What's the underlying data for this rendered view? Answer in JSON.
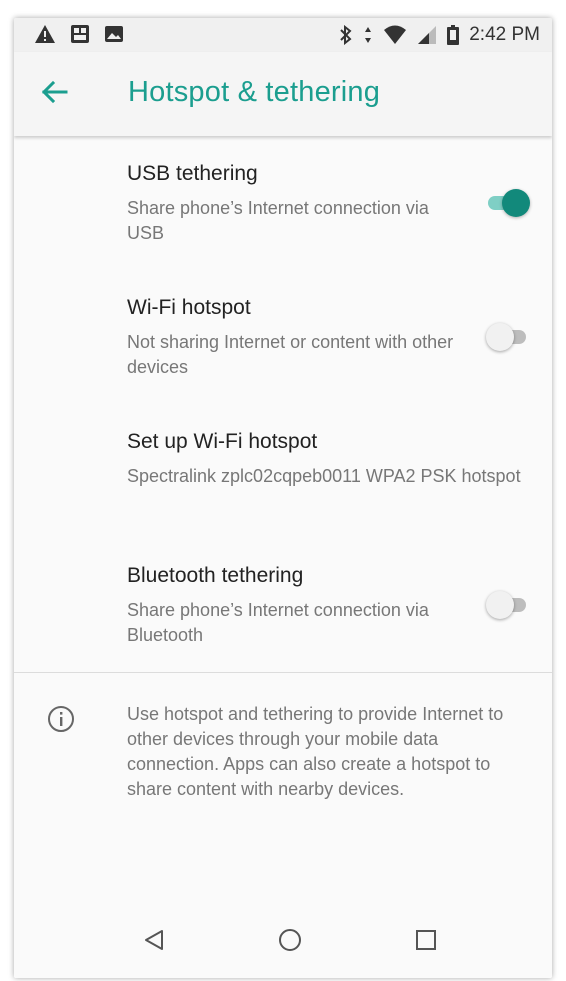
{
  "status_bar": {
    "time": "2:42 PM",
    "left_icons": [
      "warning-icon",
      "sim-icon",
      "image-icon"
    ],
    "right_icons": [
      "bluetooth-icon",
      "data-arrows-icon",
      "wifi-icon",
      "signal-icon",
      "battery-icon"
    ]
  },
  "toolbar": {
    "title": "Hotspot & tethering",
    "back_icon": "back-arrow-icon"
  },
  "settings": [
    {
      "title": "USB tethering",
      "subtitle": "Share phone’s Internet connection via USB",
      "toggle": true
    },
    {
      "title": "Wi-Fi hotspot",
      "subtitle": "Not sharing Internet or content with other devices",
      "toggle": false
    },
    {
      "title": "Set up Wi-Fi hotspot",
      "subtitle": "Spectralink zplc02cqpeb0011 WPA2 PSK hotspot"
    },
    {
      "title": "Bluetooth tethering",
      "subtitle": "Share phone’s Internet connection via Bluetooth",
      "toggle": false
    }
  ],
  "info": {
    "icon": "info-icon",
    "text": "Use hotspot and tethering to provide Internet to other devices through your mobile data connection. Apps can also create a hotspot to share content with nearby devices."
  },
  "nav_bar": {
    "icons": [
      "nav-back-icon",
      "nav-home-icon",
      "nav-recents-icon"
    ]
  },
  "colors": {
    "accent": "#1b9e8f",
    "toggle_on_thumb": "#12897b",
    "toggle_on_track": "#7fcfc5"
  }
}
